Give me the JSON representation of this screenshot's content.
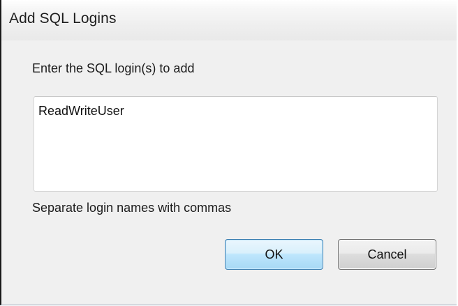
{
  "window": {
    "title": "Add SQL Logins"
  },
  "form": {
    "prompt": "Enter the SQL login(s) to add",
    "logins_value": "ReadWriteUser",
    "hint": "Separate login names with commas"
  },
  "buttons": {
    "ok_label": "OK",
    "cancel_label": "Cancel"
  },
  "colors": {
    "window_background": "#f0f0f0",
    "default_button_border": "#3c7fb1",
    "button_border": "#707070"
  }
}
